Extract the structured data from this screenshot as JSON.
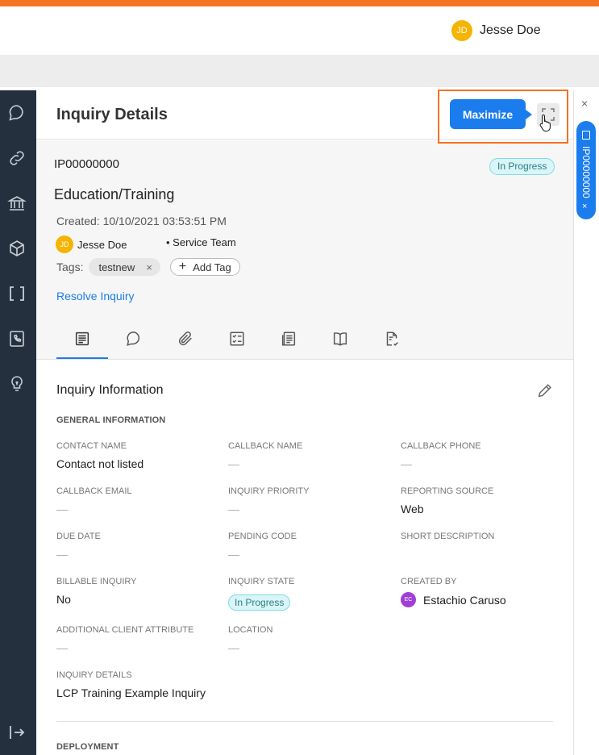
{
  "header": {
    "user_initials": "JD",
    "user_name": "Jesse Doe",
    "accent": "#f37321"
  },
  "sidebar": {
    "items": [
      "chat-icon",
      "link-icon",
      "bank-icon",
      "cube-icon",
      "brackets-icon",
      "phone-book-icon",
      "lightbulb-icon",
      "exit-icon"
    ]
  },
  "panel": {
    "title": "Inquiry Details",
    "maximize_tooltip": "Maximize",
    "inquiry_id": "IP00000000",
    "status": "In Progress",
    "inquiry_title": "Education/Training",
    "created": "Created: 10/10/2021 03:53:51 PM",
    "assignee_initials": "JD",
    "assignee": "Jesse Doe",
    "team": "• Service Team",
    "tags_label": "Tags:",
    "tags": [
      "testnew"
    ],
    "tag_remove": "×",
    "add_tag": "Add Tag",
    "resolve": "Resolve Inquiry",
    "tabs": [
      "details-icon",
      "comment-icon",
      "attachment-icon",
      "checklist-icon",
      "notes-icon",
      "book-icon",
      "document-icon"
    ]
  },
  "info": {
    "title": "Inquiry Information",
    "general_heading": "GENERAL INFORMATION",
    "fields": {
      "contact_name": {
        "label": "CONTACT NAME",
        "value": "Contact not listed"
      },
      "callback_name": {
        "label": "CALLBACK NAME",
        "value": "—"
      },
      "callback_phone": {
        "label": "CALLBACK PHONE",
        "value": "—"
      },
      "callback_email": {
        "label": "CALLBACK EMAIL",
        "value": "—"
      },
      "inquiry_priority": {
        "label": "INQUIRY PRIORITY",
        "value": "—"
      },
      "reporting_source": {
        "label": "REPORTING SOURCE",
        "value": "Web"
      },
      "due_date": {
        "label": "DUE DATE",
        "value": "—"
      },
      "pending_code": {
        "label": "PENDING CODE",
        "value": "—"
      },
      "short_description": {
        "label": "SHORT DESCRIPTION",
        "value": ""
      },
      "billable_inquiry": {
        "label": "BILLABLE INQUIRY",
        "value": "No"
      },
      "inquiry_state": {
        "label": "INQUIRY STATE",
        "value": "In Progress"
      },
      "created_by": {
        "label": "CREATED BY",
        "initials": "EC",
        "value": "Estachio Caruso"
      },
      "additional_client_attribute": {
        "label": "ADDITIONAL CLIENT ATTRIBUTE",
        "value": "—"
      },
      "location": {
        "label": "LOCATION",
        "value": "—"
      },
      "inquiry_details": {
        "label": "INQUIRY DETAILS",
        "value": "LCP Training Example Inquiry"
      }
    },
    "deployment_heading": "DEPLOYMENT"
  },
  "rightrail": {
    "close": "×",
    "tab_label": "IP00000000",
    "tab_close": "×"
  }
}
